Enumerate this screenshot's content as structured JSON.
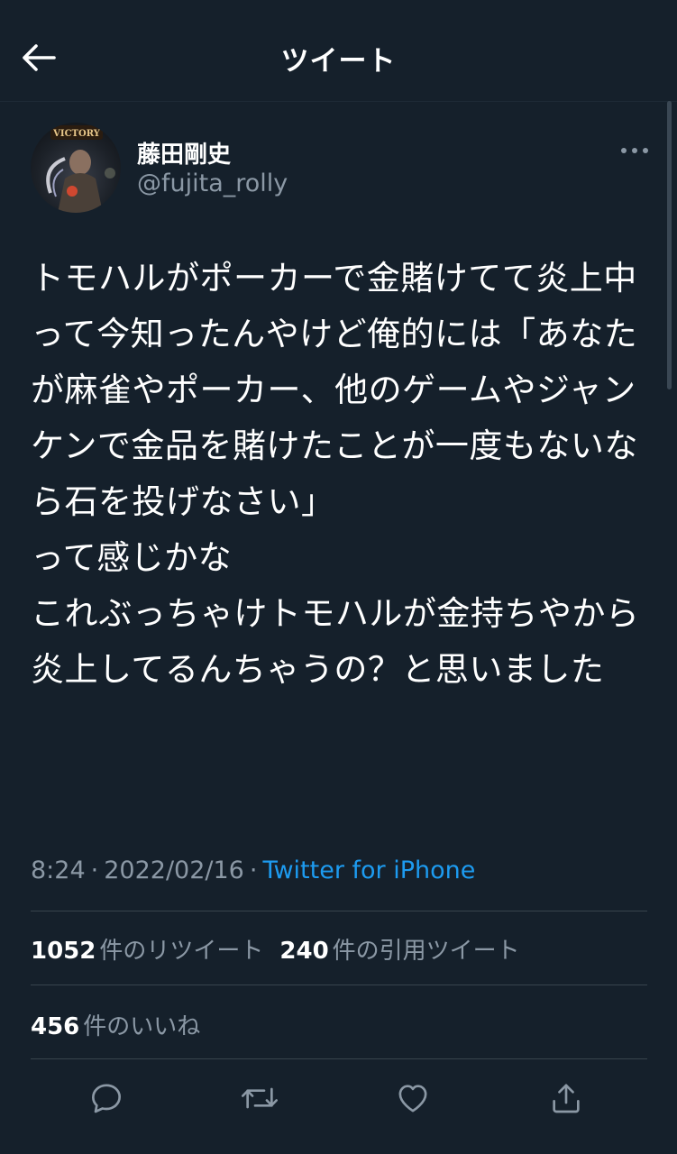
{
  "header": {
    "title": "ツイート",
    "back_icon": "arrow-left-icon"
  },
  "author": {
    "display_name": "藤田剛史",
    "username": "@fujita_rolly",
    "avatar_text": "VICTORY",
    "more_icon": "more-horizontal-icon"
  },
  "tweet": {
    "text": "トモハルがポーカーで金賭けてて炎上中って今知ったんやけど俺的には「あなたが麻雀やポーカー、他のゲームやジャンケンで金品を賭けたことが一度もないなら石を投げなさい」\nって感じかな\nこれぶっちゃけトモハルが金持ちやから炎上してるんちゃうの？と思いました"
  },
  "meta": {
    "time": "8:24",
    "separator": "·",
    "date": "2022/02/16",
    "source": "Twitter for iPhone"
  },
  "stats": {
    "retweets_count": "1052",
    "retweets_label": "件のリツイート",
    "quotes_count": "240",
    "quotes_label": "件の引用ツイート",
    "likes_count": "456",
    "likes_label": "件のいいね"
  },
  "actions": [
    "reply-icon",
    "retweet-icon",
    "like-icon",
    "share-icon"
  ],
  "colors": {
    "background": "#15202b",
    "text": "#ffffff",
    "secondary": "#8b98a5",
    "accent": "#1d9bf0",
    "divider": "#38444d"
  }
}
